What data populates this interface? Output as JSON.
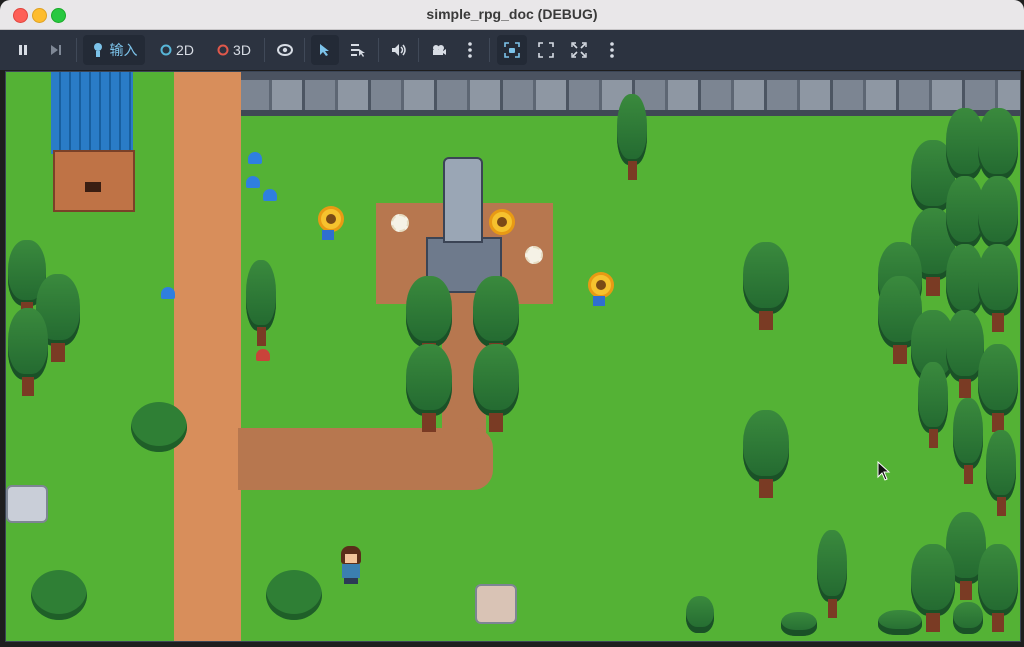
{
  "window": {
    "title": "simple_rpg_doc (DEBUG)"
  },
  "toolbar": {
    "input_label": "输入",
    "mode_2d_label": "2D",
    "mode_3d_label": "3D",
    "icons": [
      "pause-icon",
      "next-frame-icon",
      "input-icon",
      "2d-icon",
      "3d-icon",
      "eye-icon",
      "select-arrow-icon",
      "list-select-icon",
      "speaker-icon",
      "camera-icon",
      "more-icon",
      "camera-override-icon",
      "fullscreen-icon",
      "expand-icon",
      "more-icon"
    ],
    "colors": {
      "bg": "#2c3340",
      "text": "#d7dce4",
      "active_bg": "#232a36",
      "accent_2d": "#58b6d8",
      "accent_3d": "#e0584b"
    }
  },
  "game": {
    "scene": "top-down RPG village: stone wall, dirt paths, statue, pine trees, bushes, flowers, player character",
    "colors": {
      "grass": "#54b235",
      "path": "#d88e5b",
      "dirt": "#b7774f",
      "wall": "#7c8592"
    }
  }
}
